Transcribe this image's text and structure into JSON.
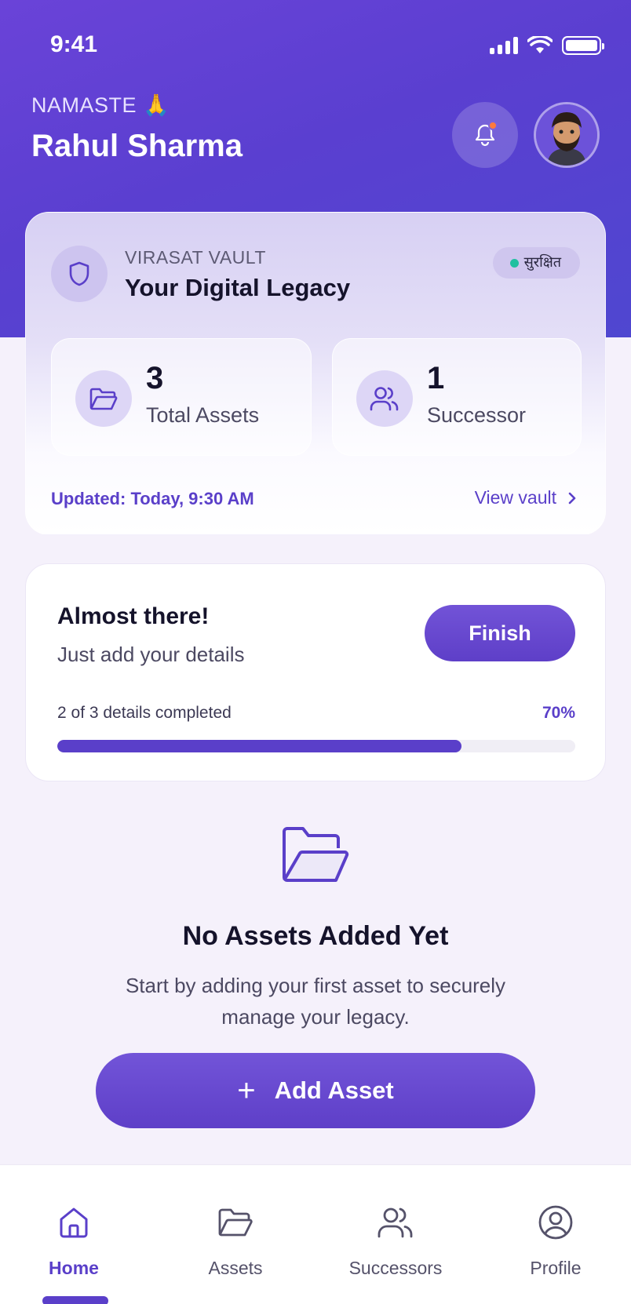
{
  "status_bar": {
    "time": "9:41"
  },
  "header": {
    "greeting": "NAMASTE 🙏",
    "user_name": "Rahul Sharma"
  },
  "vault": {
    "label": "VIRASAT VAULT",
    "title": "Your Digital Legacy",
    "badge": "सुरक्षित",
    "stats": [
      {
        "value": "3",
        "label": "Total Assets",
        "icon": "folder-icon"
      },
      {
        "value": "1",
        "label": "Successor",
        "icon": "users-icon"
      }
    ],
    "updated": "Updated: Today, 9:30 AM",
    "view_link": "View vault"
  },
  "progress": {
    "title": "Almost there!",
    "subtitle": "Just add your details",
    "button": "Finish",
    "status": "2 of 3 details completed",
    "percent_label": "70%",
    "percent": 78
  },
  "empty_state": {
    "icon": "folder-open-icon",
    "title": "No Assets Added Yet",
    "description": "Start by adding your first asset to securely manage your legacy.",
    "button": "Add Asset"
  },
  "tabs": [
    {
      "label": "Home",
      "icon": "home-icon",
      "active": true
    },
    {
      "label": "Assets",
      "icon": "folder-icon",
      "active": false
    },
    {
      "label": "Successors",
      "icon": "users-icon",
      "active": false
    },
    {
      "label": "Profile",
      "icon": "profile-icon",
      "active": false
    }
  ],
  "colors": {
    "primary": "#5a3fc9",
    "hero_start": "#6a43d8",
    "hero_end": "#4f47d0",
    "badge_dot": "#20c0a0",
    "notification_dot": "#ff7a3d"
  }
}
